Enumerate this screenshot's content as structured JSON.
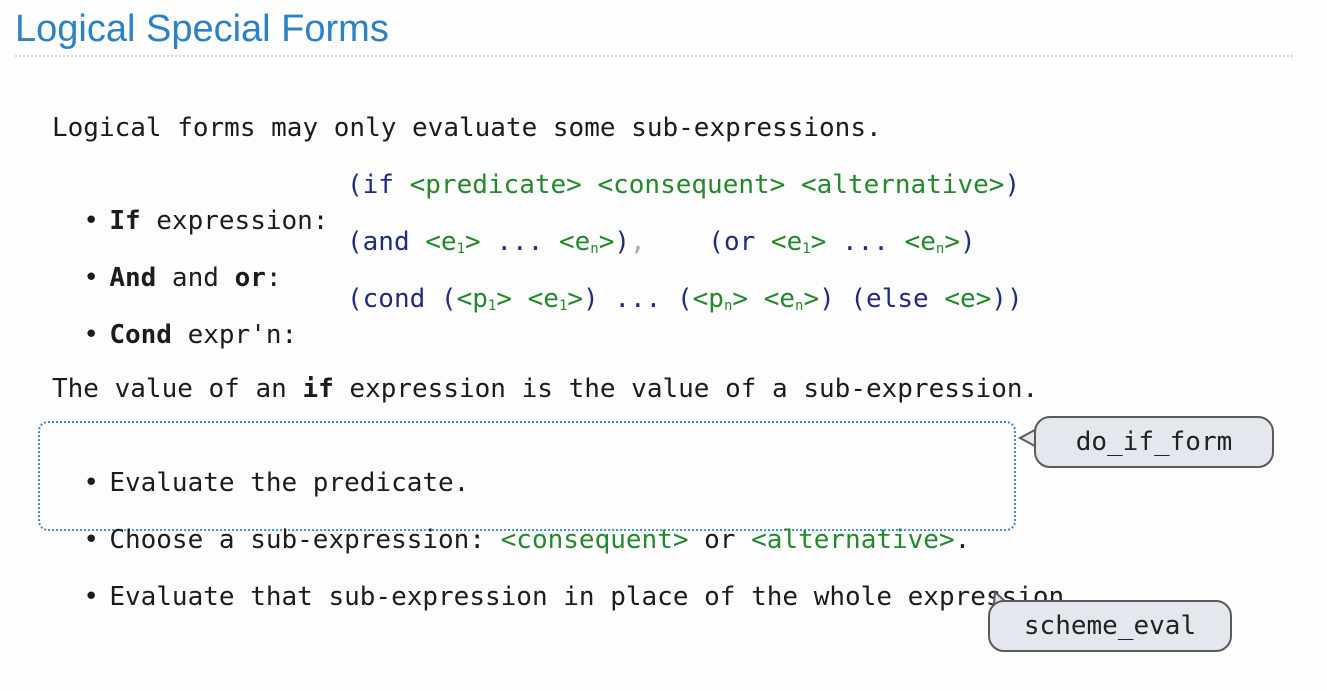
{
  "title": "Logical Special Forms",
  "intro": "Logical forms may only evaluate some sub-expressions.",
  "forms": [
    {
      "bold": "If",
      "rest": " expression:",
      "code": [
        {
          "t": "(if ",
          "c": "kw"
        },
        {
          "t": "<predicate> <consequent> <alternative>",
          "c": "gr"
        },
        {
          "t": ")",
          "c": "kw"
        }
      ]
    },
    {
      "bold": "And",
      "rest": " and ",
      "bold2": "or",
      "rest2": ":",
      "code": [
        {
          "t": "(and ",
          "c": "kw"
        },
        {
          "t": "<e",
          "c": "gr"
        },
        {
          "t": "1",
          "c": "gr",
          "sub": true
        },
        {
          "t": ">",
          "c": "gr"
        },
        {
          "t": " ... ",
          "c": "kw"
        },
        {
          "t": "<e",
          "c": "gr"
        },
        {
          "t": "n",
          "c": "gr",
          "sub": true
        },
        {
          "t": ">",
          "c": "gr"
        },
        {
          "t": ")",
          "c": "kw"
        },
        {
          "t": ",",
          "c": "comma"
        },
        {
          "t": "    (or ",
          "c": "kw"
        },
        {
          "t": "<e",
          "c": "gr"
        },
        {
          "t": "1",
          "c": "gr",
          "sub": true
        },
        {
          "t": ">",
          "c": "gr"
        },
        {
          "t": " ... ",
          "c": "kw"
        },
        {
          "t": "<e",
          "c": "gr"
        },
        {
          "t": "n",
          "c": "gr",
          "sub": true
        },
        {
          "t": ">",
          "c": "gr"
        },
        {
          "t": ")",
          "c": "kw"
        }
      ]
    },
    {
      "bold": "Cond",
      "rest": " expr'n:",
      "code": [
        {
          "t": "(cond (",
          "c": "kw"
        },
        {
          "t": "<p",
          "c": "gr"
        },
        {
          "t": "1",
          "c": "gr",
          "sub": true
        },
        {
          "t": ">",
          "c": "gr"
        },
        {
          "t": " ",
          "c": "kw"
        },
        {
          "t": "<e",
          "c": "gr"
        },
        {
          "t": "1",
          "c": "gr",
          "sub": true
        },
        {
          "t": ">",
          "c": "gr"
        },
        {
          "t": ") ... (",
          "c": "kw"
        },
        {
          "t": "<p",
          "c": "gr"
        },
        {
          "t": "n",
          "c": "gr",
          "sub": true
        },
        {
          "t": ">",
          "c": "gr"
        },
        {
          "t": " ",
          "c": "kw"
        },
        {
          "t": "<e",
          "c": "gr"
        },
        {
          "t": "n",
          "c": "gr",
          "sub": true
        },
        {
          "t": ">",
          "c": "gr"
        },
        {
          "t": ") (else ",
          "c": "kw"
        },
        {
          "t": "<e>",
          "c": "gr"
        },
        {
          "t": "))",
          "c": "kw"
        }
      ]
    }
  ],
  "if_value": {
    "before": "The value of an ",
    "bold": "if",
    "after": " expression is the value of a sub-expression."
  },
  "steps": {
    "step1": "Evaluate the predicate.",
    "step2_before": "Choose a sub-expression: ",
    "step2_consequent": "<consequent>",
    "step2_or": " or ",
    "step2_alternative": "<alternative>",
    "step2_end": ".",
    "step3": "Evaluate that sub-expression in place of the whole expression."
  },
  "bubbles": {
    "do_if_form": "do_if_form",
    "scheme_eval": "scheme_eval"
  },
  "colors": {
    "title": "#2b82c7",
    "keyword": "#222a86",
    "placeholder": "#238a2c",
    "box_border": "#3d8fd0",
    "bubble_fill": "#e5e7ef"
  }
}
